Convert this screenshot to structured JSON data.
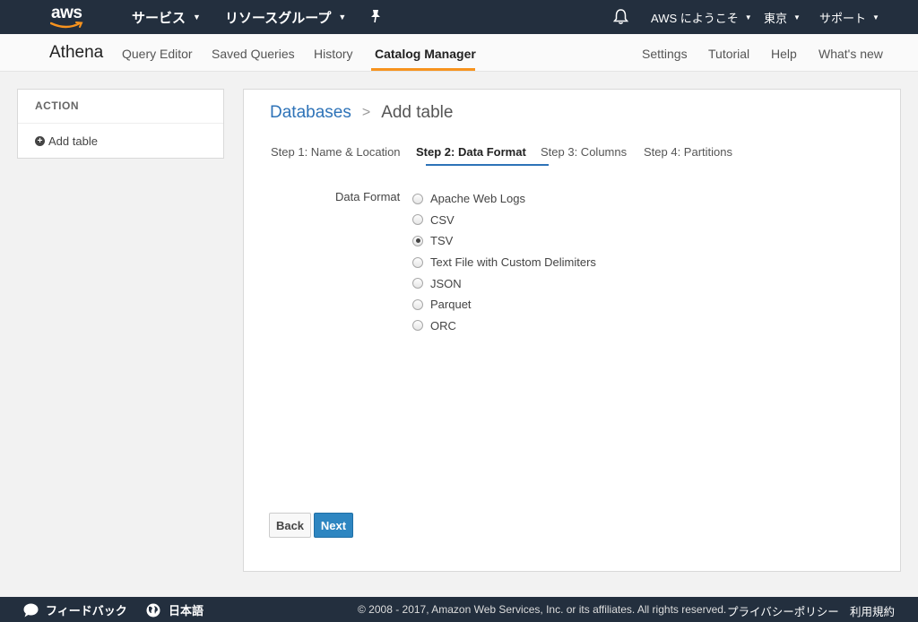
{
  "topbar": {
    "logo_text": "aws",
    "services_label": "サービス",
    "resource_groups_label": "リソースグループ",
    "welcome_label": "AWS にようこそ",
    "region_label": "東京",
    "support_label": "サポート"
  },
  "subnav": {
    "brand": "Athena",
    "links": [
      "Query Editor",
      "Saved Queries",
      "History",
      "Catalog Manager"
    ],
    "right_links": [
      "Settings",
      "Tutorial",
      "Help",
      "What's new"
    ],
    "active": "Catalog Manager"
  },
  "sidebar": {
    "heading": "ACTION",
    "add_table": "Add table"
  },
  "main": {
    "breadcrumb_link": "Databases",
    "breadcrumb_sep": ">",
    "breadcrumb_current": "Add table",
    "steps": [
      "Step 1: Name & Location",
      "Step 2: Data Format",
      "Step 3: Columns",
      "Step 4: Partitions"
    ],
    "active_step": "Step 2: Data Format",
    "data_format_label": "Data Format",
    "options": [
      "Apache Web Logs",
      "CSV",
      "TSV",
      "Text File with Custom Delimiters",
      "JSON",
      "Parquet",
      "ORC"
    ],
    "selected_option": "TSV",
    "back_button": "Back",
    "next_button": "Next"
  },
  "footer": {
    "feedback": "フィードバック",
    "language": "日本語",
    "copyright": "© 2008 - 2017, Amazon Web Services, Inc. or its affiliates. All rights reserved.",
    "privacy": "プライバシーポリシー",
    "terms": "利用規約"
  },
  "colors": {
    "topbar": "#232f3e",
    "accent_orange": "#f7931e",
    "link_blue": "#2e73b8",
    "primary_button": "#2e86c1"
  }
}
